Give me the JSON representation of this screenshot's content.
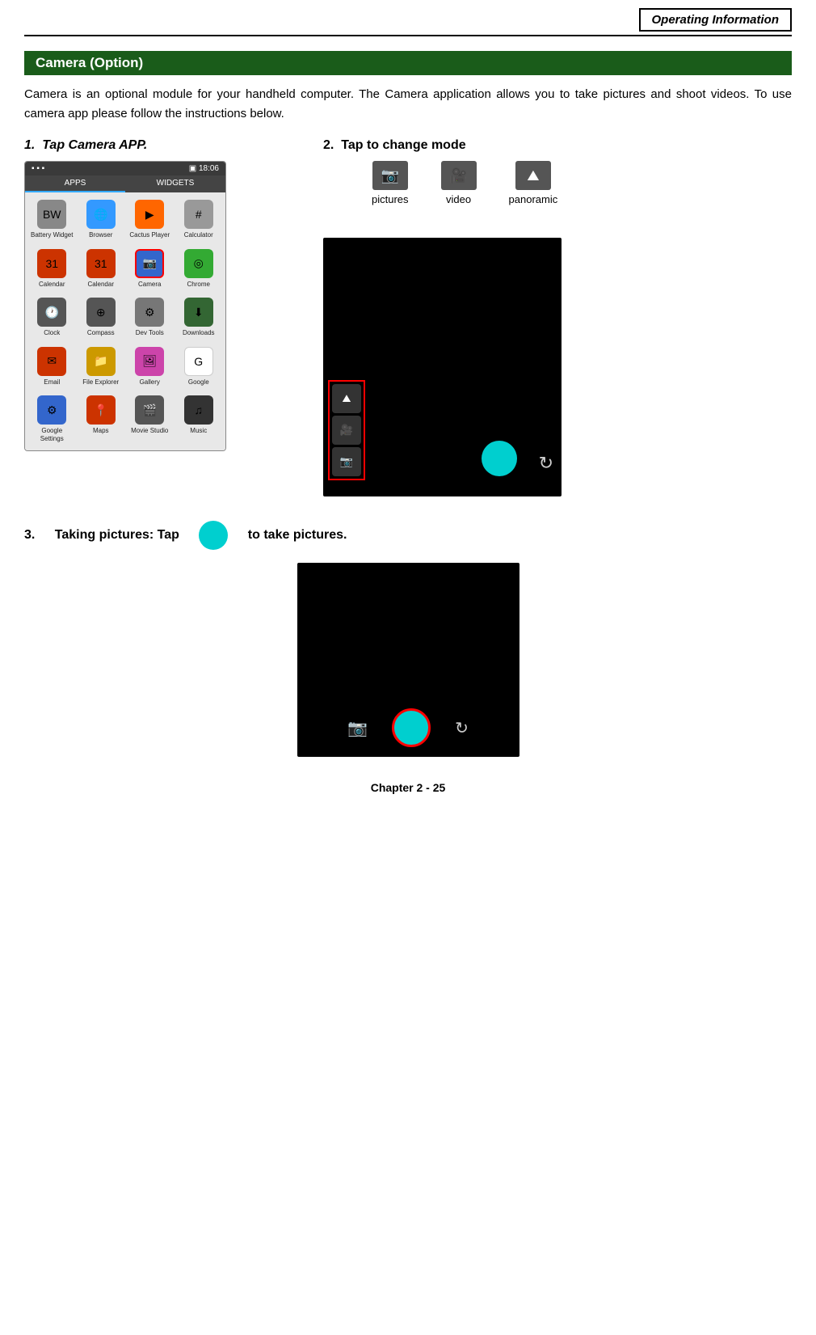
{
  "header": {
    "title": "Operating Information"
  },
  "section": {
    "title": "Camera (Option)"
  },
  "body_text": "Camera is an optional module for your handheld computer. The Camera application allows you to take pictures and shoot videos. To use camera app please follow the instructions below.",
  "step1": {
    "label": "1.",
    "text": "Tap ",
    "app_name": "Camera",
    "app_suffix": " APP."
  },
  "step2": {
    "label": "2.",
    "text": "Tap to change mode",
    "modes": [
      {
        "icon": "📷",
        "label": "pictures"
      },
      {
        "icon": "🎥",
        "label": "video"
      },
      {
        "icon": "🖼",
        "label": "panoramic"
      }
    ]
  },
  "step3": {
    "label": "3.",
    "text_before": "Taking pictures: Tap",
    "text_after": "to take pictures."
  },
  "phone": {
    "topbar_left": "▪ ▪ ▪",
    "topbar_right": "▣ 18:06",
    "tabs": [
      "APPS",
      "WIDGETS"
    ],
    "apps": [
      {
        "label": "Battery\nWidget",
        "icon": "BW",
        "color": "icon-bw"
      },
      {
        "label": "Browser",
        "icon": "🌐",
        "color": "icon-browser"
      },
      {
        "label": "Cactus Player",
        "icon": "▶",
        "color": "icon-cactus"
      },
      {
        "label": "Calculator",
        "icon": "#",
        "color": "icon-calc"
      },
      {
        "label": "Calendar",
        "icon": "31",
        "color": "icon-calendar1"
      },
      {
        "label": "Calendar",
        "icon": "31",
        "color": "icon-calendar2"
      },
      {
        "label": "Camera",
        "icon": "📷",
        "color": "icon-camera",
        "highlighted": true
      },
      {
        "label": "Chrome",
        "icon": "◎",
        "color": "icon-chrome"
      },
      {
        "label": "Clock",
        "icon": "🕐",
        "color": "icon-clock"
      },
      {
        "label": "Compass",
        "icon": "⊕",
        "color": "icon-compass"
      },
      {
        "label": "Dev Tools",
        "icon": "⚙",
        "color": "icon-devtools"
      },
      {
        "label": "Downloads",
        "icon": "⬇",
        "color": "icon-downloads"
      },
      {
        "label": "Email",
        "icon": "✉",
        "color": "icon-email"
      },
      {
        "label": "File Explorer",
        "icon": "📁",
        "color": "icon-files"
      },
      {
        "label": "Gallery",
        "icon": "🖼",
        "color": "icon-gallery"
      },
      {
        "label": "Google",
        "icon": "G",
        "color": "icon-google"
      },
      {
        "label": "Google\nSettings",
        "icon": "⚙",
        "color": "icon-gsettings"
      },
      {
        "label": "Maps",
        "icon": "📍",
        "color": "icon-maps"
      },
      {
        "label": "Movie Studio",
        "icon": "🎬",
        "color": "icon-movie"
      },
      {
        "label": "Music",
        "icon": "♫",
        "color": "icon-music"
      }
    ]
  },
  "footer": {
    "text": "Chapter 2 - 25"
  }
}
